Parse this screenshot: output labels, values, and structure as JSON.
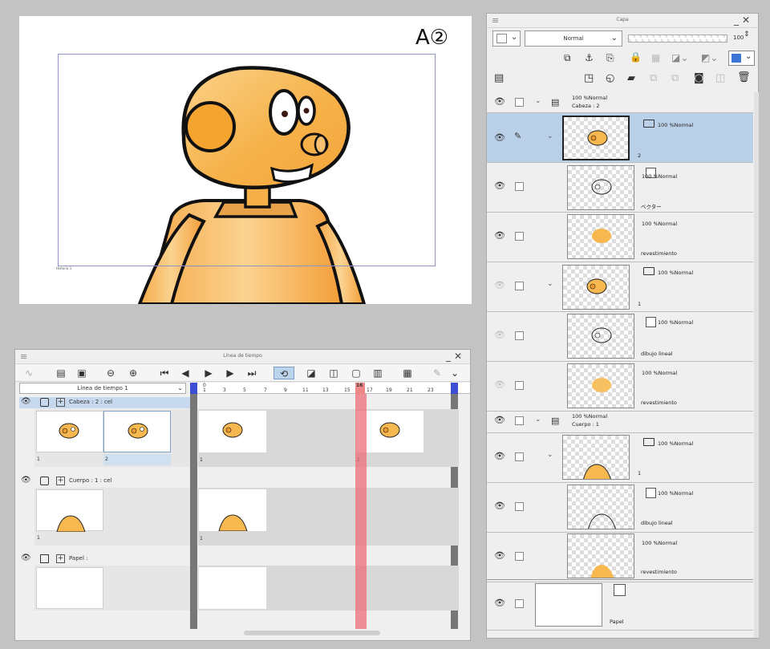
{
  "canvas": {
    "cut_label": "A②",
    "frame_label": "Historia 1"
  },
  "timeline": {
    "window_title": "Línea de tiempo",
    "timeline_selector": "Línea de tiempo 1",
    "ruler_ticks": [
      "0",
      "1",
      "3",
      "5",
      "7",
      "9",
      "11",
      "13",
      "15",
      "16",
      "17",
      "19",
      "21",
      "23"
    ],
    "current_frame": "16",
    "tracks": [
      {
        "name": "Cabeza : 2 : cel",
        "cels": [
          "1",
          "2"
        ],
        "timeline_marks": [
          "1",
          "2"
        ]
      },
      {
        "name": "Cuerpo : 1 : cel",
        "cels": [
          "1"
        ],
        "timeline_marks": [
          "1"
        ]
      },
      {
        "name": "Papel :",
        "cels": [],
        "timeline_marks": []
      }
    ]
  },
  "layers": {
    "window_title": "Capa",
    "blend_mode": "Normal",
    "opacity": "100",
    "accent_color": "#3b73d6",
    "selected_color": "#b9d0e8",
    "rows": [
      {
        "mode": "100 %Normal",
        "name": "Cabeza : 2"
      },
      {
        "mode": "100 %Normal",
        "name": "2"
      },
      {
        "mode": "100 %Normal",
        "name": "ベクター"
      },
      {
        "mode": "100 %Normal",
        "name": "revestimiento"
      },
      {
        "mode": "100 %Normal",
        "name": "1"
      },
      {
        "mode": "100 %Normal",
        "name": "dibujo lineal"
      },
      {
        "mode": "100 %Normal",
        "name": "revestimiento"
      },
      {
        "mode": "100 %Normal",
        "name": "Cuerpo : 1"
      },
      {
        "mode": "100 %Normal",
        "name": "1"
      },
      {
        "mode": "100 %Normal",
        "name": "dibujo lineal"
      },
      {
        "mode": "100 %Normal",
        "name": "revestimiento"
      },
      {
        "mode": "",
        "name": "Papel"
      }
    ]
  }
}
